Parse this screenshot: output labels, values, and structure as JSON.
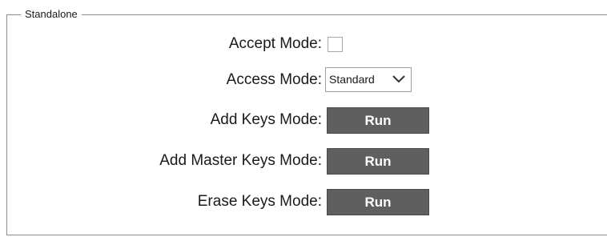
{
  "group": {
    "legend": "Standalone"
  },
  "accept_mode": {
    "label": "Accept Mode:",
    "checked": false
  },
  "access_mode": {
    "label": "Access Mode:",
    "selected": "Standard",
    "icon": "chevron-down-icon"
  },
  "add_keys_mode": {
    "label": "Add Keys Mode:",
    "button": "Run"
  },
  "add_master_keys_mode": {
    "label": "Add Master Keys Mode:",
    "button": "Run"
  },
  "erase_keys_mode": {
    "label": "Erase Keys Mode:",
    "button": "Run"
  },
  "colors": {
    "button_bg": "#5f5f5f",
    "button_text": "#ffffff",
    "border": "#8c8c8c"
  }
}
